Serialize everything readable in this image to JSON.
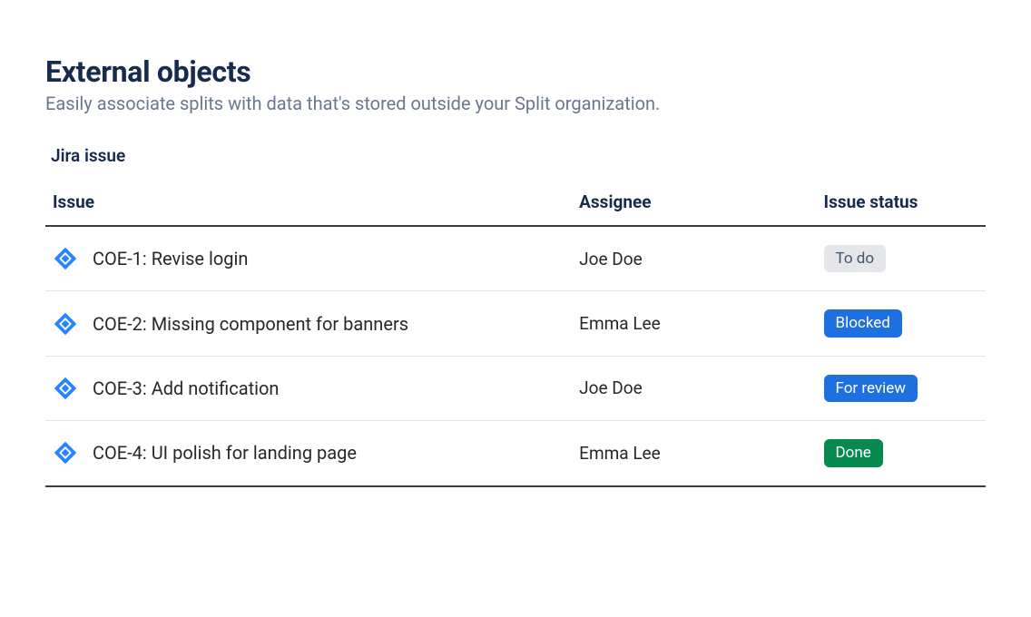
{
  "header": {
    "title": "External objects",
    "subtitle": "Easily associate splits with data that's stored outside your Split organization."
  },
  "section": {
    "label": "Jira issue"
  },
  "table": {
    "columns": {
      "issue": "Issue",
      "assignee": "Assignee",
      "status": "Issue status"
    },
    "rows": [
      {
        "icon": "jira-icon",
        "title": "COE-1: Revise login",
        "assignee": "Joe Doe",
        "status_label": "To do",
        "status_key": "todo"
      },
      {
        "icon": "jira-icon",
        "title": "COE-2: Missing component for banners",
        "assignee": "Emma Lee",
        "status_label": "Blocked",
        "status_key": "blocked"
      },
      {
        "icon": "jira-icon",
        "title": "COE-3: Add notification",
        "assignee": "Joe Doe",
        "status_label": "For review",
        "status_key": "review"
      },
      {
        "icon": "jira-icon",
        "title": "COE-4: UI polish for landing page",
        "assignee": "Emma Lee",
        "status_label": "Done",
        "status_key": "done"
      }
    ]
  },
  "colors": {
    "status_todo_bg": "#e4e6ea",
    "status_todo_fg": "#44546b",
    "status_blue_bg": "#1e6fe0",
    "status_blue_fg": "#ffffff",
    "status_done_bg": "#078a50",
    "status_done_fg": "#ffffff",
    "jira_icon": "#2684ff"
  }
}
